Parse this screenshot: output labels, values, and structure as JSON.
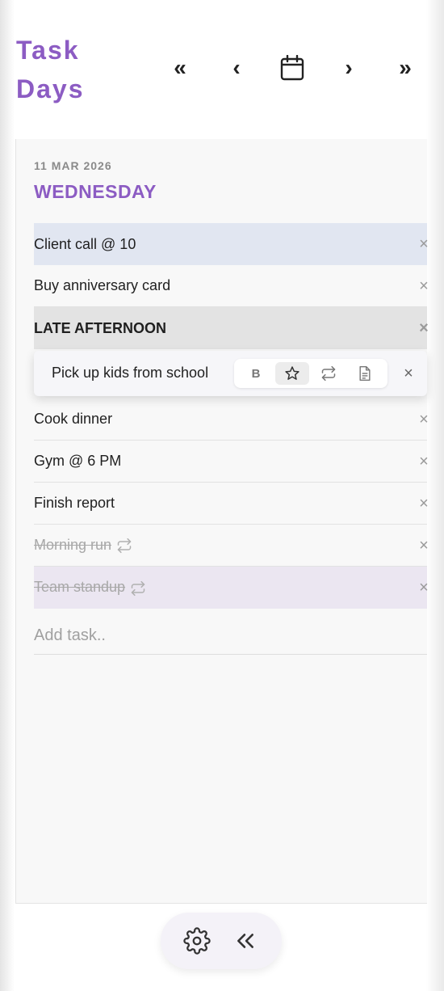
{
  "app": {
    "title_line1": "Task",
    "title_line2": "Days",
    "accent_color": "#8c5cc3"
  },
  "nav": {
    "prev_week": "«",
    "prev_day": "‹",
    "calendar_icon": "calendar-icon",
    "next_day": "›",
    "next_week": "»"
  },
  "day": {
    "date": "11 MAR 2026",
    "weekday": "WEDNESDAY"
  },
  "tasks": [
    {
      "label": "Client call @ 10",
      "style": "highlight-blue",
      "done": false
    },
    {
      "label": "Buy anniversary card",
      "style": "normal",
      "done": false
    },
    {
      "label": "LATE AFTERNOON",
      "style": "heading",
      "done": false
    },
    {
      "label": "Pick up kids from school",
      "style": "editing",
      "done": false
    },
    {
      "label": "Cook dinner",
      "style": "normal",
      "done": false
    },
    {
      "label": "Gym @ 6 PM",
      "style": "normal",
      "done": false
    },
    {
      "label": "Finish report",
      "style": "normal",
      "done": false
    },
    {
      "label": "Morning run",
      "style": "normal",
      "done": true,
      "repeat": true
    },
    {
      "label": "Team standup",
      "style": "highlight-lilac",
      "done": true,
      "repeat": true
    }
  ],
  "delete_glyph": "×",
  "toolbar": {
    "bold_label": "B",
    "star_icon": "star-icon",
    "repeat_icon": "repeat-icon",
    "note_icon": "note-icon",
    "selected": "star"
  },
  "add_task": {
    "placeholder": "Add task.."
  },
  "bottom": {
    "settings_icon": "gear-icon",
    "collapse_label": "«"
  }
}
